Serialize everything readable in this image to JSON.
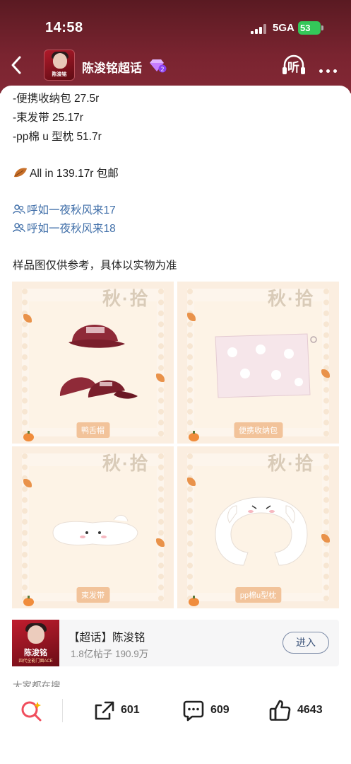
{
  "status_bar": {
    "time": "14:58",
    "network": "5GA",
    "battery": "53"
  },
  "nav": {
    "title": "陈浚铭超话",
    "avatar_text": "陈浚铭",
    "listen_label": "听"
  },
  "post": {
    "lines": [
      "-便携收纳包 27.5r",
      "-束发带 25.17r",
      "-pp棉 u 型枕 51.7r"
    ],
    "all_in": "All in 139.17r 包邮",
    "links": [
      "呼如一夜秋风来17",
      "呼如一夜秋风来18"
    ],
    "note": "样品图仅供参考，具体以实物为准",
    "images": [
      {
        "title": "秋·拾",
        "label": "鸭舌帽"
      },
      {
        "title": "秋·拾",
        "label": "便携收纳包"
      },
      {
        "title": "秋·拾",
        "label": "束发带"
      },
      {
        "title": "秋·拾",
        "label": "pp棉u型枕"
      }
    ]
  },
  "topic_card": {
    "thumb_name": "陈浚铭",
    "thumb_sub": "四代全能门面ACE",
    "title": "【超话】陈浚铭",
    "stats": "1.8亿帖子 190.9万",
    "join_label": "进入"
  },
  "also_searching": "大家都在搜",
  "bottom_bar": {
    "repost_count": "601",
    "comment_count": "609",
    "like_count": "4643"
  },
  "colors": {
    "header_bg": "#7a2430",
    "link": "#3f6ea8",
    "card_bg": "#fbeee0",
    "battery": "#34c759"
  }
}
